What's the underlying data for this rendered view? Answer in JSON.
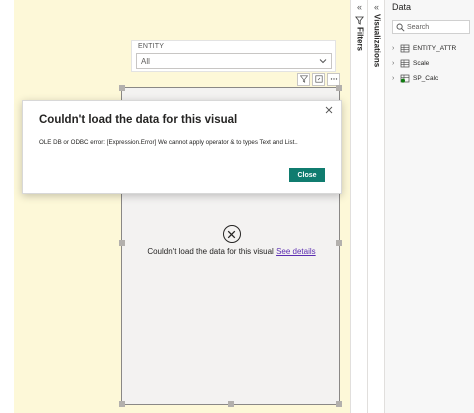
{
  "slicer": {
    "title": "ENTITY",
    "value": "All"
  },
  "visual": {
    "error_text": "Couldn't load the data for this visual",
    "see_details": "See details"
  },
  "dialog": {
    "title": "Couldn't load the data for this visual",
    "message": "OLE DB or ODBC error: [Expression.Error] We cannot apply operator & to types Text and List..",
    "close_button": "Close"
  },
  "panes": {
    "filters_label": "Filters",
    "visualizations_label": "Visualizations",
    "data_title": "Data",
    "search_placeholder": "Search",
    "fields": [
      {
        "name": "ENTITY_ATTR",
        "icon": "table-icon"
      },
      {
        "name": "Scale",
        "icon": "table-icon"
      },
      {
        "name": "SP_Calc",
        "icon": "calculated-table-icon"
      }
    ]
  },
  "colors": {
    "canvas": "#fdf8d8",
    "accent": "#107c6f",
    "link": "#5b2db1",
    "field_badge": "#107c10"
  }
}
